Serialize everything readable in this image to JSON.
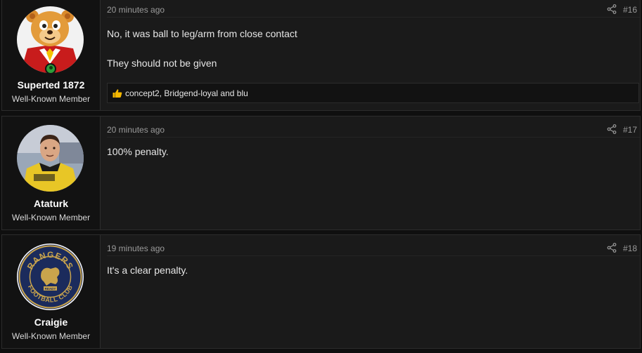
{
  "posts": [
    {
      "username": "Superted 1872",
      "user_title": "Well-Known Member",
      "online": true,
      "timestamp": "20 minutes ago",
      "post_number": "#16",
      "message": [
        "No, it was ball to leg/arm from close contact",
        "They should not be given"
      ],
      "reactions": "concept2, Bridgend-loyal and blu",
      "avatar_icon": "cartoon-bear-avatar"
    },
    {
      "username": "Ataturk",
      "user_title": "Well-Known Member",
      "online": false,
      "timestamp": "20 minutes ago",
      "post_number": "#17",
      "message": [
        "100% penalty."
      ],
      "avatar_icon": "footballer-photo-avatar"
    },
    {
      "username": "Craigie",
      "user_title": "Well-Known Member",
      "online": false,
      "timestamp": "19 minutes ago",
      "post_number": "#18",
      "message": [
        "It's a clear penalty."
      ],
      "avatar_icon": "rangers-crest-avatar",
      "crest_text": {
        "top": "RANGERS",
        "bottom": "FOOTBALL CLUB",
        "motto": "READY"
      }
    }
  ],
  "colors": {
    "background": "#0f0f0f",
    "post_bg": "#1a1a1a",
    "user_col_bg": "#121212",
    "online": "#2e9c3a",
    "like": "#f5b800"
  }
}
